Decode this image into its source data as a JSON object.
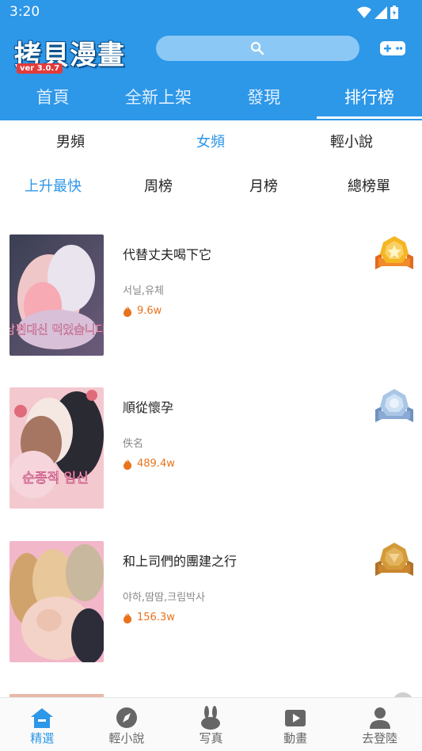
{
  "status_bar": {
    "time": "3:20"
  },
  "header": {
    "logo_text": "拷貝漫畫",
    "version": "ver 3.0.7",
    "search_icon": "search-icon",
    "game_icon": "gamepad-icon"
  },
  "top_tabs": [
    {
      "label": "首頁",
      "active": false
    },
    {
      "label": "全新上架",
      "active": false
    },
    {
      "label": "發現",
      "active": false
    },
    {
      "label": "排行榜",
      "active": true
    }
  ],
  "gender_tabs": [
    {
      "label": "男頻",
      "active": false
    },
    {
      "label": "女頻",
      "active": true
    },
    {
      "label": "輕小說",
      "active": false
    }
  ],
  "rank_tabs": [
    {
      "label": "上升最快",
      "active": true
    },
    {
      "label": "周榜",
      "active": false
    },
    {
      "label": "月榜",
      "active": false
    },
    {
      "label": "總榜單",
      "active": false
    }
  ],
  "comics": [
    {
      "title": "代替丈夫喝下它",
      "author": "서닐,유체",
      "hot": "9.6w",
      "medal": "gold-medal-icon",
      "cover_text": "남편대신 먹었습니다"
    },
    {
      "title": "順從懷孕",
      "author": "佚名",
      "hot": "489.4w",
      "medal": "silver-medal-icon",
      "cover_text": "순종적 임신"
    },
    {
      "title": "和上司們的團建之行",
      "author": "야하,땀땀,크림박사",
      "hot": "156.3w",
      "medal": "bronze-medal-icon",
      "cover_text": ""
    }
  ],
  "colors": {
    "brand": "#2d97e8",
    "hot": "#e8731c",
    "gold": "#f5b623",
    "silver": "#a9c6e6",
    "bronze": "#d49a3a"
  },
  "bottom_nav": [
    {
      "label": "精選",
      "icon": "home-icon",
      "active": true
    },
    {
      "label": "輕小說",
      "icon": "compass-icon",
      "active": false
    },
    {
      "label": "写真",
      "icon": "rabbit-icon",
      "active": false
    },
    {
      "label": "動畫",
      "icon": "play-icon",
      "active": false
    },
    {
      "label": "去登陸",
      "icon": "user-icon",
      "active": false
    }
  ]
}
